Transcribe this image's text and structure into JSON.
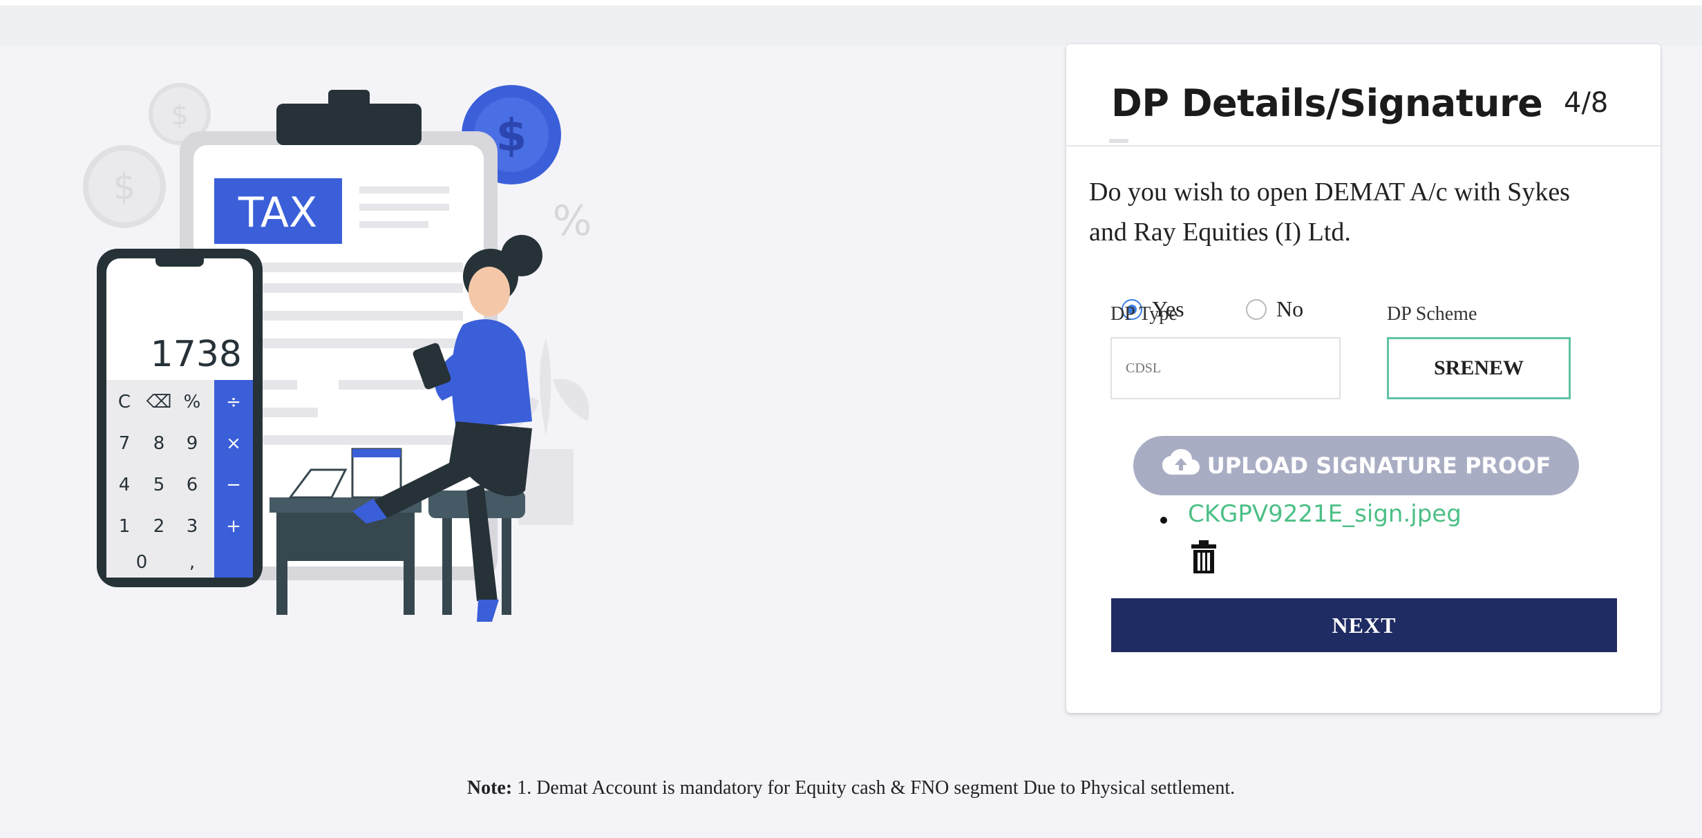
{
  "illustration": {
    "tax_label": "TAX",
    "calculator_display": "1738",
    "calculator_keys": [
      [
        "C",
        "⌫",
        "%",
        "÷"
      ],
      [
        "7",
        "8",
        "9",
        "×"
      ],
      [
        "4",
        "5",
        "6",
        "−"
      ],
      [
        "1",
        "2",
        "3",
        "+"
      ],
      [
        "0",
        "",
        ",",
        "="
      ]
    ],
    "dollar_symbol": "$",
    "percent_symbol": "%",
    "accent_color": "#3b5fd9"
  },
  "card": {
    "title": "DP Details/Signature",
    "step": "4/8",
    "question": "Do you wish to open DEMAT A/c with Sykes and Ray Equities (I) Ltd.",
    "options": [
      {
        "label": "Yes",
        "checked": true
      },
      {
        "label": "No",
        "checked": false
      }
    ],
    "dp_type": {
      "label": "DP Type",
      "value": "CDSL"
    },
    "dp_scheme": {
      "label": "DP Scheme",
      "value": "SRENEW"
    },
    "upload_label": "UPLOAD SIGNATURE PROOF",
    "upload_icon": "cloud-upload-icon",
    "uploaded_files": [
      {
        "name": "CKGPV9221E_sign.jpeg"
      }
    ],
    "delete_icon": "trash-icon",
    "next_label": "NEXT"
  },
  "note": {
    "label": "Note:",
    "text": " 1. Demat Account is mandatory for Equity cash & FNO segment Due to Physical settlement."
  },
  "colors": {
    "primary_navy": "#1f2b63",
    "radio_blue": "#3a7de0",
    "scheme_border": "#5fc3a6",
    "file_green": "#4cbf86",
    "upload_gray": "#a9adc4"
  }
}
